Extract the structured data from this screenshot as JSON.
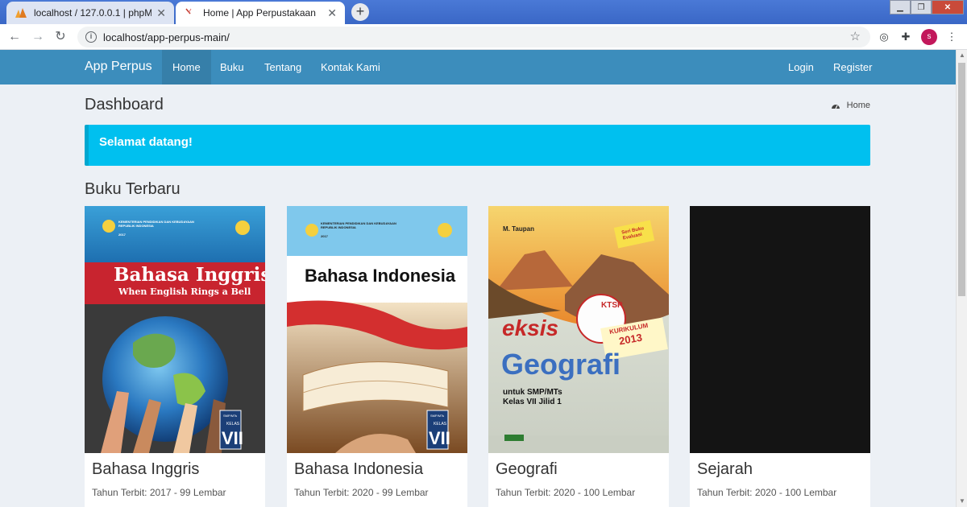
{
  "browser": {
    "tabs": [
      {
        "title": "localhost / 127.0.0.1 | phpMyAdmin",
        "active": false
      },
      {
        "title": "Home | App Perpustakaan",
        "active": true
      }
    ],
    "new_tab": "+",
    "url": "localhost/app-perpus-main/",
    "profile_initial": "s"
  },
  "navbar": {
    "brand": "App Perpus",
    "links": [
      "Home",
      "Buku",
      "Tentang",
      "Kontak Kami"
    ],
    "right_links": [
      "Login",
      "Register"
    ]
  },
  "content": {
    "title": "Dashboard",
    "breadcrumb": "Home"
  },
  "callout": {
    "text": "Selamat datang!"
  },
  "books_section": {
    "title": "Buku Terbaru",
    "books": [
      {
        "title": "Bahasa Inggris",
        "meta": "Tahun Terbit: 2017 - 99 Lembar",
        "cover_title": "Bahasa Inggris",
        "cover_subtitle": "When English Rings a Bell",
        "ministry": "KEMENTERIAN PENDIDIKAN DAN KEBUDAYAAN REPUBLIK INDONESIA",
        "cover_year": "2017",
        "grade_top": "SMP/MTs",
        "grade_kelas": "KELAS",
        "grade_num": "VII"
      },
      {
        "title": "Bahasa Indonesia",
        "meta": "Tahun Terbit: 2020 - 99 Lembar",
        "cover_title": "Bahasa Indonesia",
        "ministry": "KEMENTERIAN PENDIDIKAN DAN KEBUDAYAAN REPUBLIK INDONESIA",
        "cover_year": "2017",
        "grade_top": "SMP/MTs",
        "grade_kelas": "KELAS",
        "grade_num": "VII"
      },
      {
        "title": "Geografi",
        "meta": "Tahun Terbit: 2020 - 100 Lembar",
        "cover_author": "M. Taupan",
        "cover_brand": "eksis",
        "cover_title": "Geografi",
        "cover_sub1": "untuk SMP/MTs",
        "cover_sub2": "Kelas VII Jilid 1",
        "badge_seri": "Seri Buku Evaluasi",
        "badge_ktsp": "KTSP",
        "badge_kurikulum": "KURIKULUM",
        "badge_year": "2013"
      },
      {
        "title": "Sejarah",
        "meta": "Tahun Terbit: 2020 - 100 Lembar"
      }
    ]
  }
}
